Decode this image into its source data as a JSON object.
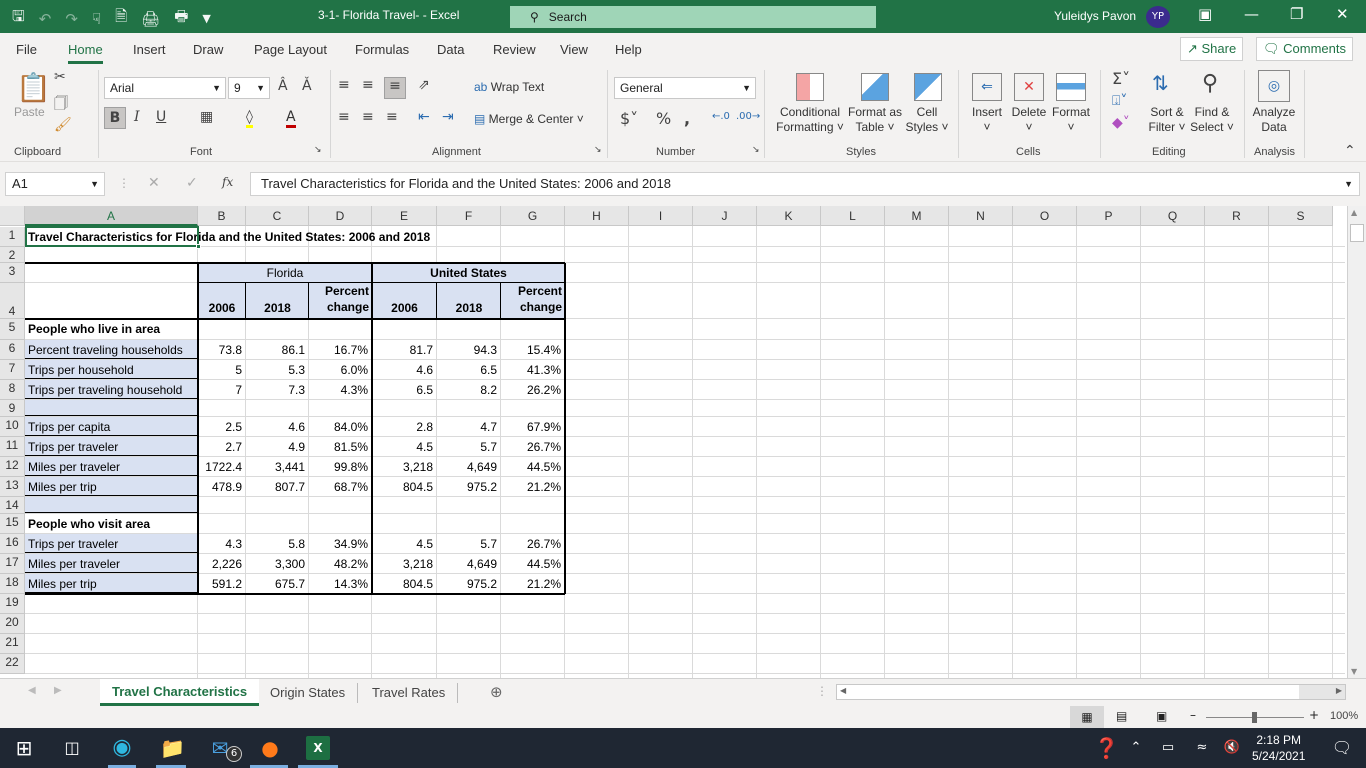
{
  "titlebar": {
    "doc_title": "3-1- Florida Travel- - Excel",
    "search_placeholder": "Search",
    "user_name": "Yuleidys Pavon",
    "user_initials": "YP"
  },
  "menu_tabs": [
    "File",
    "Home",
    "Insert",
    "Draw",
    "Page Layout",
    "Formulas",
    "Data",
    "Review",
    "View",
    "Help"
  ],
  "active_tab": "Home",
  "share_label": "Share",
  "comments_label": "Comments",
  "ribbon": {
    "clipboard": {
      "label": "Clipboard",
      "paste": "Paste"
    },
    "font": {
      "label": "Font",
      "font_name": "Arial",
      "font_size": "9"
    },
    "alignment": {
      "label": "Alignment",
      "wrap_text": "Wrap Text",
      "merge_center": "Merge & Center"
    },
    "number": {
      "label": "Number",
      "format": "General"
    },
    "styles": {
      "label": "Styles",
      "conditional1": "Conditional",
      "conditional2": "Formatting",
      "format_table1": "Format as",
      "format_table2": "Table",
      "cell_styles1": "Cell",
      "cell_styles2": "Styles"
    },
    "cells": {
      "label": "Cells",
      "insert": "Insert",
      "delete": "Delete",
      "format": "Format"
    },
    "editing": {
      "label": "Editing",
      "sort1": "Sort &",
      "sort2": "Filter",
      "find1": "Find &",
      "find2": "Select"
    },
    "analysis": {
      "label": "Analysis",
      "analyze1": "Analyze",
      "analyze2": "Data"
    }
  },
  "formula_bar": {
    "name_box": "A1",
    "fx": "fx",
    "formula": "Travel Characteristics for Florida and the United States:  2006 and 2018"
  },
  "columns": [
    "A",
    "B",
    "C",
    "D",
    "E",
    "F",
    "G",
    "H",
    "I",
    "J",
    "K",
    "L",
    "M",
    "N",
    "O",
    "P",
    "Q",
    "R",
    "S"
  ],
  "rows": [
    "1",
    "2",
    "3",
    "4",
    "5",
    "6",
    "7",
    "8",
    "9",
    "10",
    "11",
    "12",
    "13",
    "14",
    "15",
    "16",
    "17",
    "18",
    "19",
    "20",
    "21",
    "22"
  ],
  "sheet": {
    "title": "Travel Characteristics for Florida and the United States:  2006 and 2018",
    "florida": "Florida",
    "us": "United States",
    "year1": "2006",
    "year2": "2018",
    "pct1": "Percent",
    "pct2": "change",
    "section1": "People who live in area",
    "section2": "People who visit area",
    "data_rows": [
      {
        "row": 6,
        "label": "Percent traveling households",
        "fl06": "73.8",
        "fl18": "86.1",
        "flp": "16.7%",
        "us06": "81.7",
        "us18": "94.3",
        "usp": "15.4%"
      },
      {
        "row": 7,
        "label": "Trips per household",
        "fl06": "5",
        "fl18": "5.3",
        "flp": "6.0%",
        "us06": "4.6",
        "us18": "6.5",
        "usp": "41.3%"
      },
      {
        "row": 8,
        "label": "Trips per traveling household",
        "fl06": "7",
        "fl18": "7.3",
        "flp": "4.3%",
        "us06": "6.5",
        "us18": "8.2",
        "usp": "26.2%"
      },
      {
        "row": 10,
        "label": "Trips per capita",
        "fl06": "2.5",
        "fl18": "4.6",
        "flp": "84.0%",
        "us06": "2.8",
        "us18": "4.7",
        "usp": "67.9%"
      },
      {
        "row": 11,
        "label": "Trips per traveler",
        "fl06": "2.7",
        "fl18": "4.9",
        "flp": "81.5%",
        "us06": "4.5",
        "us18": "5.7",
        "usp": "26.7%"
      },
      {
        "row": 12,
        "label": "Miles per traveler",
        "fl06": "1722.4",
        "fl18": "3,441",
        "flp": "99.8%",
        "us06": "3,218",
        "us18": "4,649",
        "usp": "44.5%"
      },
      {
        "row": 13,
        "label": "Miles per trip",
        "fl06": "478.9",
        "fl18": "807.7",
        "flp": "68.7%",
        "us06": "804.5",
        "us18": "975.2",
        "usp": "21.2%"
      },
      {
        "row": 16,
        "label": "Trips per traveler",
        "fl06": "4.3",
        "fl18": "5.8",
        "flp": "34.9%",
        "us06": "4.5",
        "us18": "5.7",
        "usp": "26.7%"
      },
      {
        "row": 17,
        "label": "Miles per traveler",
        "fl06": "2,226",
        "fl18": "3,300",
        "flp": "48.2%",
        "us06": "3,218",
        "us18": "4,649",
        "usp": "44.5%"
      },
      {
        "row": 18,
        "label": "Miles per trip",
        "fl06": "591.2",
        "fl18": "675.7",
        "flp": "14.3%",
        "us06": "804.5",
        "us18": "975.2",
        "usp": "21.2%"
      }
    ]
  },
  "sheet_tabs": [
    "Travel Characteristics",
    "Origin States",
    "Travel Rates"
  ],
  "active_sheet": "Travel Characteristics",
  "status": {
    "zoom": "100%"
  },
  "taskbar": {
    "mail_badge": "6",
    "time": "2:18 PM",
    "date": "5/24/2021"
  },
  "colors": {
    "excel_green": "#217346",
    "header_fill": "#d9e1f2"
  }
}
